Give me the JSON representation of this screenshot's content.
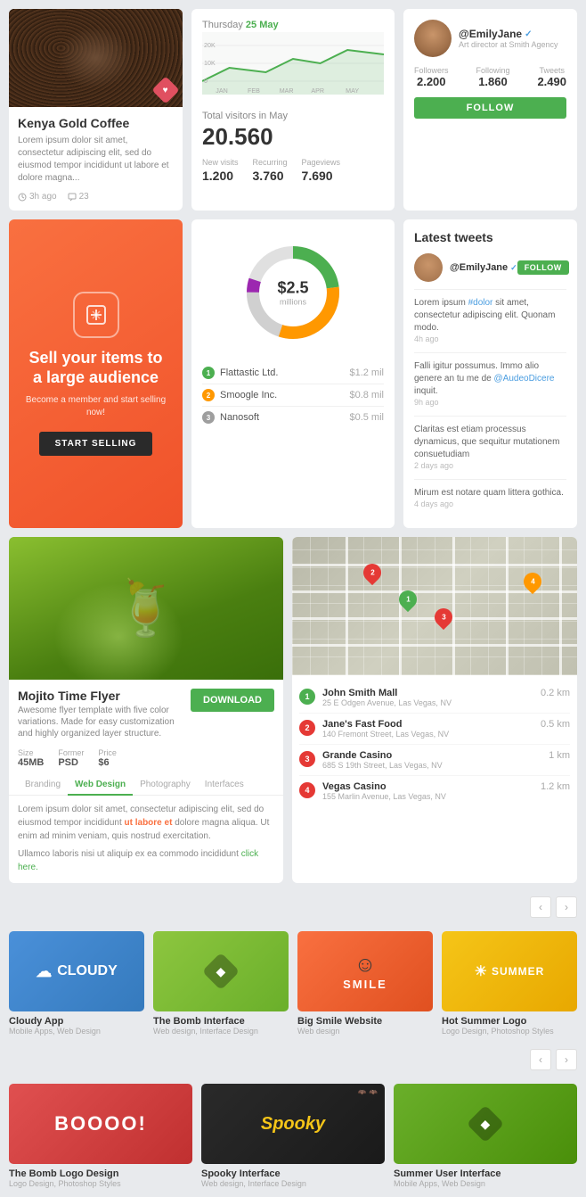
{
  "row1": {
    "coffee": {
      "title": "Kenya Gold Coffee",
      "description": "Lorem ipsum dolor sit amet, consectetur adipiscing elit, sed do eiusmod tempor incididunt ut labore et dolore magna...",
      "time": "3h ago",
      "comments": "23"
    },
    "chart": {
      "date_label": "Thursday",
      "date_day": "25 May",
      "total_label": "Total visitors in May",
      "total_value": "20.560",
      "stats": [
        {
          "label": "New visits",
          "value": "1.200"
        },
        {
          "label": "Recurring",
          "value": "3.760"
        },
        {
          "label": "Pageviews",
          "value": "7.690"
        }
      ],
      "y_labels": [
        "20K",
        "10K",
        "0"
      ],
      "x_labels": [
        "JAN",
        "FEB",
        "MAR",
        "APR",
        "MAY"
      ]
    },
    "profile": {
      "name": "@EmilyJane",
      "title": "Art director at Smith Agency",
      "followers_label": "Followers",
      "followers_value": "2.200",
      "following_label": "Following",
      "following_value": "1.860",
      "tweets_label": "Tweets",
      "tweets_value": "2.490",
      "follow_btn": "FOLLOW"
    }
  },
  "row2": {
    "sell": {
      "headline": "Sell your items to a large audience",
      "subtext": "Become a member and start selling now!",
      "btn": "START SELLING"
    },
    "donut": {
      "amount": "$2.5",
      "unit": "millions",
      "items": [
        {
          "num": "1",
          "name": "Flattastic Ltd.",
          "value": "$1.2 mil"
        },
        {
          "num": "2",
          "name": "Smoogle Inc.",
          "value": "$0.8 mil"
        },
        {
          "num": "3",
          "name": "Nanosoft",
          "value": "$0.5 mil"
        }
      ]
    },
    "tweets": {
      "title": "Latest tweets",
      "author": "@EmilyJane",
      "follow_btn": "FOLLOW",
      "items": [
        {
          "text": "Lorem ipsum #dolor sit amet, consectetur adipiscing elit. Quonam modo.",
          "time": "4h ago"
        },
        {
          "text": "Falli igitur possumus. Immo alio genere an tu me de @AudeoDicere inquit.",
          "time": "9h ago"
        },
        {
          "text": "Claritas est etiam processus dynamicus, que sequitur mutationem consuetudiam",
          "time": "2 days ago"
        },
        {
          "text": "Mirum est notare quam littera gothica.",
          "time": "4 days ago"
        }
      ]
    }
  },
  "row3": {
    "flyer": {
      "title": "Mojito Time Flyer",
      "description": "Awesome flyer template with five color variations. Made for easy customization and highly organized layer structure.",
      "download_btn": "DOWNLOAD",
      "size_label": "Size",
      "size_value": "45MB",
      "format_label": "Former",
      "format_value": "PSD",
      "price_label": "Price",
      "price_value": "$6",
      "tabs": [
        "Branding",
        "Web Design",
        "Photography",
        "Interfaces"
      ],
      "active_tab": "Web Design",
      "tab_content": "Lorem ipsum dolor sit amet, consectetur adipiscing elit, sed do eiusmod tempor incididunt ut labore et dolore magna aliqua. Ut enim ad minim veniam, quis nostrud exercitation.",
      "tab_content2": "Ullamco laboris nisi ut aliquip ex ea commodo incididunt click here.",
      "highlight_text": "ut labore et",
      "link_text": "click here."
    },
    "map": {
      "locations": [
        {
          "num": "1",
          "name": "John Smith Mall",
          "address": "25 E Odgen Avenue, Las Vegas, NV",
          "dist": "0.2 km"
        },
        {
          "num": "2",
          "name": "Jane's Fast Food",
          "address": "140 Fremont Street, Las Vegas, NV",
          "dist": "0.5 km"
        },
        {
          "num": "3",
          "name": "Grande Casino",
          "address": "685 S 19th Street, Las Vegas, NV",
          "dist": "1 km"
        },
        {
          "num": "4",
          "name": "Vegas Casino",
          "address": "155 Marlin Avenue, Las Vegas, NV",
          "dist": "1.2 km"
        }
      ]
    }
  },
  "portfolio1": {
    "items": [
      {
        "title": "Cloudy App",
        "cat": "Mobile Apps, Web Design"
      },
      {
        "title": "The Bomb Interface",
        "cat": "Web design, Interface Design"
      },
      {
        "title": "Big Smile Website",
        "cat": "Web design"
      },
      {
        "title": "Hot Summer Logo",
        "cat": "Logo Design, Photoshop Styles"
      }
    ]
  },
  "portfolio2": {
    "items": [
      {
        "title": "The Bomb Logo Design",
        "cat": "Logo Design, Photoshop Styles"
      },
      {
        "title": "Spooky Interface",
        "cat": "Web design, Interface Design"
      },
      {
        "title": "Summer User Interface",
        "cat": "Mobile Apps, Web Design"
      }
    ]
  },
  "nav": {
    "prev": "‹",
    "next": "›"
  }
}
